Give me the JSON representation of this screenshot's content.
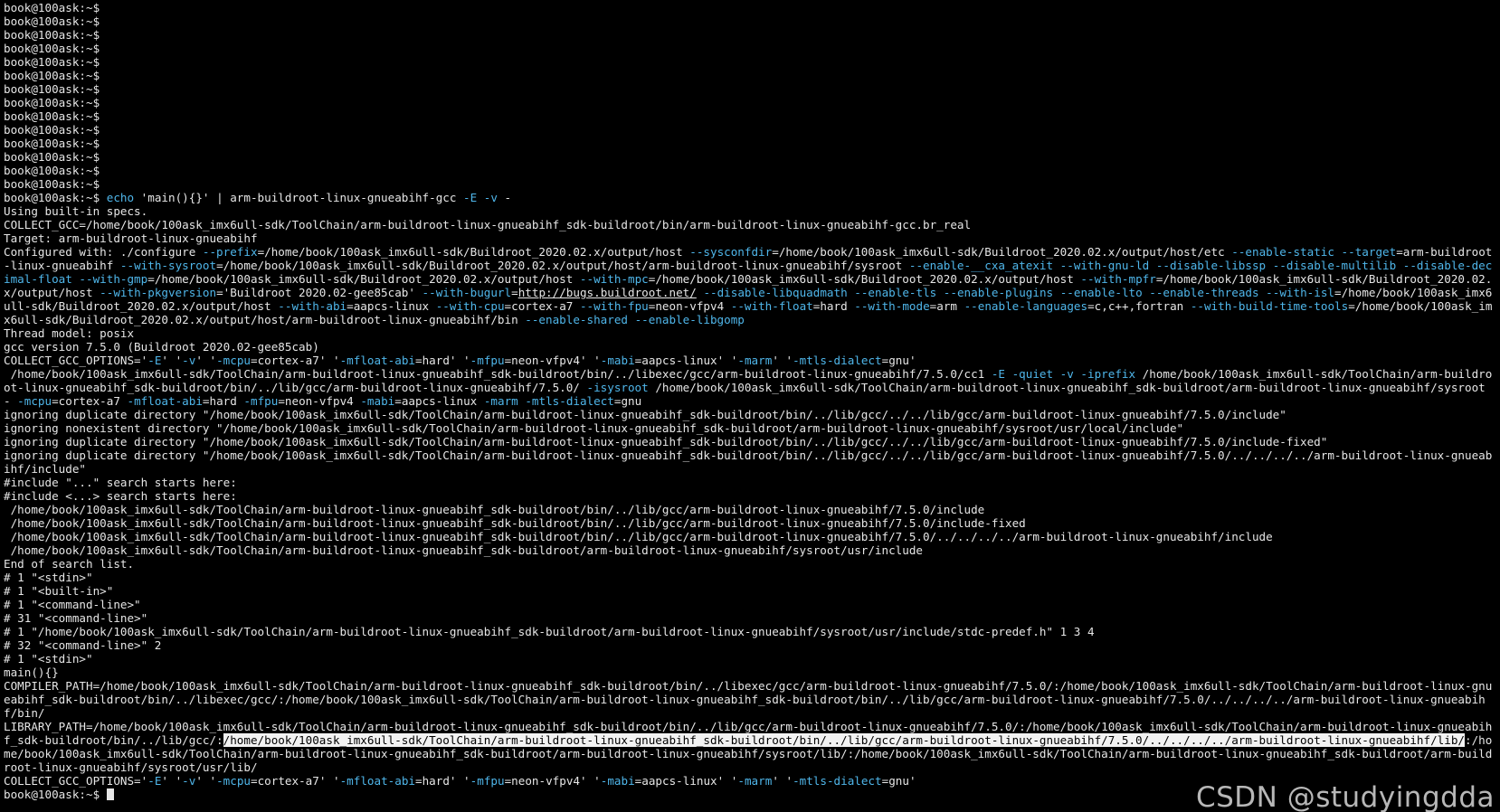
{
  "terminal": {
    "colors": {
      "background": "#000000",
      "foreground": "#e6e6e6",
      "option": "#4fb6ea",
      "selection_bg": "#f2f2f2",
      "selection_fg": "#000000"
    },
    "lines": [
      [
        {
          "t": "book@100ask:~$"
        }
      ],
      [
        {
          "t": "book@100ask:~$"
        }
      ],
      [
        {
          "t": "book@100ask:~$"
        }
      ],
      [
        {
          "t": "book@100ask:~$"
        }
      ],
      [
        {
          "t": "book@100ask:~$"
        }
      ],
      [
        {
          "t": "book@100ask:~$"
        }
      ],
      [
        {
          "t": "book@100ask:~$"
        }
      ],
      [
        {
          "t": "book@100ask:~$"
        }
      ],
      [
        {
          "t": "book@100ask:~$"
        }
      ],
      [
        {
          "t": "book@100ask:~$"
        }
      ],
      [
        {
          "t": "book@100ask:~$"
        }
      ],
      [
        {
          "t": "book@100ask:~$"
        }
      ],
      [
        {
          "t": "book@100ask:~$"
        }
      ],
      [
        {
          "t": "book@100ask:~$"
        }
      ],
      [
        {
          "t": "book@100ask:~$ "
        },
        {
          "t": "echo",
          "c": "opt"
        },
        {
          "t": " 'main(){}' | arm-buildroot-linux-gnueabihf-gcc "
        },
        {
          "t": "-E -v",
          "c": "opt"
        },
        {
          "t": " -"
        }
      ],
      [
        {
          "t": "Using built-in specs."
        }
      ],
      [
        {
          "t": "COLLECT_GCC=/home/book/100ask_imx6ull-sdk/ToolChain/arm-buildroot-linux-gnueabihf_sdk-buildroot/bin/arm-buildroot-linux-gnueabihf-gcc.br_real"
        }
      ],
      [
        {
          "t": "Target: arm-buildroot-linux-gnueabihf"
        }
      ],
      [
        {
          "t": "Configured with: ./configure "
        },
        {
          "t": "--prefix",
          "c": "opt"
        },
        {
          "t": "=/home/book/100ask_imx6ull-sdk/Buildroot_2020.02.x/output/host "
        },
        {
          "t": "--sysconfdir",
          "c": "opt"
        },
        {
          "t": "=/home/book/100ask_imx6ull-sdk/Buildroot_2020.02.x/output/host/etc "
        },
        {
          "t": "--enable-static --target",
          "c": "opt"
        },
        {
          "t": "=arm-buildroot-linux-gnueabihf "
        },
        {
          "t": "--with-sysroot",
          "c": "opt"
        },
        {
          "t": "=/home/book/100ask_imx6ull-sdk/Buildroot_2020.02.x/output/host/arm-buildroot-linux-gnueabihf/sysroot "
        },
        {
          "t": "--enable-__cxa_atexit --with-gnu-ld --disable-libssp --disable-multilib --disable-decimal-float --with-gmp",
          "c": "opt"
        },
        {
          "t": "=/home/book/100ask_imx6ull-sdk/Buildroot_2020.02.x/output/host "
        },
        {
          "t": "--with-mpc",
          "c": "opt"
        },
        {
          "t": "=/home/book/100ask_imx6ull-sdk/Buildroot_2020.02.x/output/host "
        },
        {
          "t": "--with-mpfr",
          "c": "opt"
        },
        {
          "t": "=/home/book/100ask_imx6ull-sdk/Buildroot_2020.02.x/output/host "
        },
        {
          "t": "--with-pkgversion",
          "c": "opt"
        },
        {
          "t": "='Buildroot 2020.02-gee85cab' "
        },
        {
          "t": "--with-bugurl",
          "c": "opt"
        },
        {
          "t": "="
        },
        {
          "t": "http://bugs.buildroot.net/",
          "c": "link"
        },
        {
          "t": " "
        },
        {
          "t": "--disable-libquadmath --enable-tls --enable-plugins --enable-lto --enable-threads --with-isl",
          "c": "opt"
        },
        {
          "t": "=/home/book/100ask_imx6ull-sdk/Buildroot_2020.02.x/output/host "
        },
        {
          "t": "--with-abi",
          "c": "opt"
        },
        {
          "t": "=aapcs-linux "
        },
        {
          "t": "--with-cpu",
          "c": "opt"
        },
        {
          "t": "=cortex-a7 "
        },
        {
          "t": "--with-fpu",
          "c": "opt"
        },
        {
          "t": "=neon-vfpv4 "
        },
        {
          "t": "--with-float",
          "c": "opt"
        },
        {
          "t": "=hard "
        },
        {
          "t": "--with-mode",
          "c": "opt"
        },
        {
          "t": "=arm "
        },
        {
          "t": "--enable-languages",
          "c": "opt"
        },
        {
          "t": "=c,c++,fortran "
        },
        {
          "t": "--with-build-time-tools",
          "c": "opt"
        },
        {
          "t": "=/home/book/100ask_imx6ull-sdk/Buildroot_2020.02.x/output/host/arm-buildroot-linux-gnueabihf/bin "
        },
        {
          "t": "--enable-shared --enable-libgomp",
          "c": "opt"
        }
      ],
      [
        {
          "t": "Thread model: posix"
        }
      ],
      [
        {
          "t": "gcc version 7.5.0 (Buildroot 2020.02-gee85cab)"
        }
      ],
      [
        {
          "t": "COLLECT_GCC_OPTIONS='"
        },
        {
          "t": "-E",
          "c": "opt"
        },
        {
          "t": "' '"
        },
        {
          "t": "-v",
          "c": "opt"
        },
        {
          "t": "' '"
        },
        {
          "t": "-mcpu",
          "c": "opt"
        },
        {
          "t": "=cortex-a7' '"
        },
        {
          "t": "-mfloat-abi",
          "c": "opt"
        },
        {
          "t": "=hard' '"
        },
        {
          "t": "-mfpu",
          "c": "opt"
        },
        {
          "t": "=neon-vfpv4' '"
        },
        {
          "t": "-mabi",
          "c": "opt"
        },
        {
          "t": "=aapcs-linux' '"
        },
        {
          "t": "-marm",
          "c": "opt"
        },
        {
          "t": "' '"
        },
        {
          "t": "-mtls-dialect",
          "c": "opt"
        },
        {
          "t": "=gnu'"
        }
      ],
      [
        {
          "t": " /home/book/100ask_imx6ull-sdk/ToolChain/arm-buildroot-linux-gnueabihf_sdk-buildroot/bin/../libexec/gcc/arm-buildroot-linux-gnueabihf/7.5.0/cc1 "
        },
        {
          "t": "-E -quiet -v -iprefix",
          "c": "opt"
        },
        {
          "t": " /home/book/100ask_imx6ull-sdk/ToolChain/arm-buildroot-linux-gnueabihf_sdk-buildroot/bin/../lib/gcc/arm-buildroot-linux-gnueabihf/7.5.0/ "
        },
        {
          "t": "-isysroot",
          "c": "opt"
        },
        {
          "t": " /home/book/100ask_imx6ull-sdk/ToolChain/arm-buildroot-linux-gnueabihf_sdk-buildroot/arm-buildroot-linux-gnueabihf/sysroot - "
        },
        {
          "t": "-mcpu",
          "c": "opt"
        },
        {
          "t": "=cortex-a7 "
        },
        {
          "t": "-mfloat-abi",
          "c": "opt"
        },
        {
          "t": "=hard "
        },
        {
          "t": "-mfpu",
          "c": "opt"
        },
        {
          "t": "=neon-vfpv4 "
        },
        {
          "t": "-mabi",
          "c": "opt"
        },
        {
          "t": "=aapcs-linux "
        },
        {
          "t": "-marm -mtls-dialect",
          "c": "opt"
        },
        {
          "t": "=gnu"
        }
      ],
      [
        {
          "t": "ignoring duplicate directory \"/home/book/100ask_imx6ull-sdk/ToolChain/arm-buildroot-linux-gnueabihf_sdk-buildroot/bin/../lib/gcc/../../lib/gcc/arm-buildroot-linux-gnueabihf/7.5.0/include\""
        }
      ],
      [
        {
          "t": "ignoring nonexistent directory \"/home/book/100ask_imx6ull-sdk/ToolChain/arm-buildroot-linux-gnueabihf_sdk-buildroot/arm-buildroot-linux-gnueabihf/sysroot/usr/local/include\""
        }
      ],
      [
        {
          "t": "ignoring duplicate directory \"/home/book/100ask_imx6ull-sdk/ToolChain/arm-buildroot-linux-gnueabihf_sdk-buildroot/bin/../lib/gcc/../../lib/gcc/arm-buildroot-linux-gnueabihf/7.5.0/include-fixed\""
        }
      ],
      [
        {
          "t": "ignoring duplicate directory \"/home/book/100ask_imx6ull-sdk/ToolChain/arm-buildroot-linux-gnueabihf_sdk-buildroot/bin/../lib/gcc/../../lib/gcc/arm-buildroot-linux-gnueabihf/7.5.0/../../../../arm-buildroot-linux-gnueabihf/include\""
        }
      ],
      [
        {
          "t": "#include \"...\" search starts here:"
        }
      ],
      [
        {
          "t": "#include <...> search starts here:"
        }
      ],
      [
        {
          "t": " /home/book/100ask_imx6ull-sdk/ToolChain/arm-buildroot-linux-gnueabihf_sdk-buildroot/bin/../lib/gcc/arm-buildroot-linux-gnueabihf/7.5.0/include"
        }
      ],
      [
        {
          "t": " /home/book/100ask_imx6ull-sdk/ToolChain/arm-buildroot-linux-gnueabihf_sdk-buildroot/bin/../lib/gcc/arm-buildroot-linux-gnueabihf/7.5.0/include-fixed"
        }
      ],
      [
        {
          "t": " /home/book/100ask_imx6ull-sdk/ToolChain/arm-buildroot-linux-gnueabihf_sdk-buildroot/bin/../lib/gcc/arm-buildroot-linux-gnueabihf/7.5.0/../../../../arm-buildroot-linux-gnueabihf/include"
        }
      ],
      [
        {
          "t": " /home/book/100ask_imx6ull-sdk/ToolChain/arm-buildroot-linux-gnueabihf_sdk-buildroot/arm-buildroot-linux-gnueabihf/sysroot/usr/include"
        }
      ],
      [
        {
          "t": "End of search list."
        }
      ],
      [
        {
          "t": "# 1 \"<stdin>\""
        }
      ],
      [
        {
          "t": "# 1 \"<built-in>\""
        }
      ],
      [
        {
          "t": "# 1 \"<command-line>\""
        }
      ],
      [
        {
          "t": "# 31 \"<command-line>\""
        }
      ],
      [
        {
          "t": "# 1 \"/home/book/100ask_imx6ull-sdk/ToolChain/arm-buildroot-linux-gnueabihf_sdk-buildroot/arm-buildroot-linux-gnueabihf/sysroot/usr/include/stdc-predef.h\" 1 3 4"
        }
      ],
      [
        {
          "t": "# 32 \"<command-line>\" 2"
        }
      ],
      [
        {
          "t": "# 1 \"<stdin>\""
        }
      ],
      [
        {
          "t": "main(){}"
        }
      ],
      [
        {
          "t": "COMPILER_PATH=/home/book/100ask_imx6ull-sdk/ToolChain/arm-buildroot-linux-gnueabihf_sdk-buildroot/bin/../libexec/gcc/arm-buildroot-linux-gnueabihf/7.5.0/:/home/book/100ask_imx6ull-sdk/ToolChain/arm-buildroot-linux-gnueabihf_sdk-buildroot/bin/../libexec/gcc/:/home/book/100ask_imx6ull-sdk/ToolChain/arm-buildroot-linux-gnueabihf_sdk-buildroot/bin/../lib/gcc/arm-buildroot-linux-gnueabihf/7.5.0/../../../../arm-buildroot-linux-gnueabihf/bin/"
        }
      ],
      [
        {
          "t": "LIBRARY_PATH=/home/book/100ask_imx6ull-sdk/ToolChain/arm-buildroot-linux-gnueabihf_sdk-buildroot/bin/../lib/gcc/arm-buildroot-linux-gnueabihf/7.5.0/:/home/book/100ask_imx6ull-sdk/ToolChain/arm-buildroot-linux-gnueabihf_sdk-buildroot/bin/../lib/gcc/:"
        },
        {
          "t": "/home/book/100ask_imx6ull-sdk/ToolChain/arm-buildroot-linux-gnueabihf_sdk-buildroot/bin/../lib/gcc/arm-buildroot-linux-gnueabihf/7.5.0/../../../../arm-buildroot-linux-gnueabihf/lib/",
          "c": "sel"
        },
        {
          "t": ":/home/book/100ask_imx6ull-sdk/ToolChain/arm-buildroot-linux-gnueabihf_sdk-buildroot/arm-buildroot-linux-gnueabihf/sysroot/lib/:/home/book/100ask_imx6ull-sdk/ToolChain/arm-buildroot-linux-gnueabihf_sdk-buildroot/arm-buildroot-linux-gnueabihf/sysroot/usr/lib/"
        }
      ],
      [
        {
          "t": "COLLECT_GCC_OPTIONS='"
        },
        {
          "t": "-E",
          "c": "opt"
        },
        {
          "t": "' '"
        },
        {
          "t": "-v",
          "c": "opt"
        },
        {
          "t": "' '"
        },
        {
          "t": "-mcpu",
          "c": "opt"
        },
        {
          "t": "=cortex-a7' '"
        },
        {
          "t": "-mfloat-abi",
          "c": "opt"
        },
        {
          "t": "=hard' '"
        },
        {
          "t": "-mfpu",
          "c": "opt"
        },
        {
          "t": "=neon-vfpv4' '"
        },
        {
          "t": "-mabi",
          "c": "opt"
        },
        {
          "t": "=aapcs-linux' '"
        },
        {
          "t": "-marm",
          "c": "opt"
        },
        {
          "t": "' '"
        },
        {
          "t": "-mtls-dialect",
          "c": "opt"
        },
        {
          "t": "=gnu'"
        }
      ],
      [
        {
          "t": "book@100ask:~$ "
        },
        {
          "cursor": true
        }
      ]
    ]
  },
  "watermark": {
    "text": "CSDN @studyingdda"
  }
}
